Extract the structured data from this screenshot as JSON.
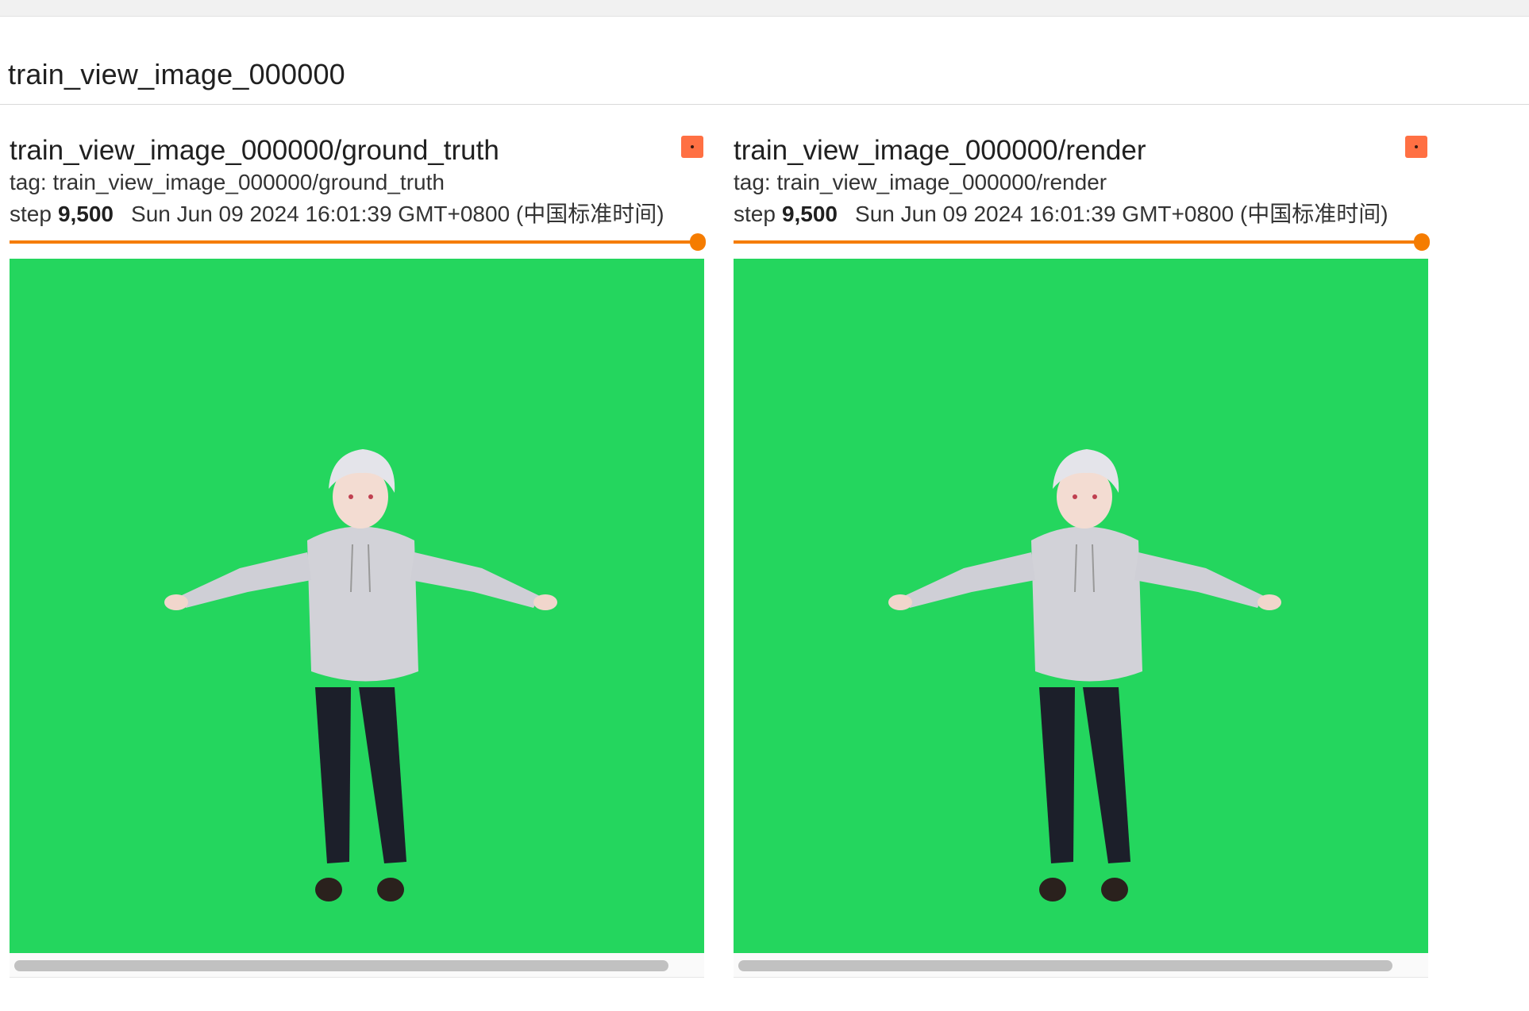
{
  "group": {
    "title": "train_view_image_000000"
  },
  "cards": [
    {
      "title": "train_view_image_000000/ground_truth",
      "tag": "tag: train_view_image_000000/ground_truth",
      "step_label": "step",
      "step_value": "9,500",
      "timestamp": "Sun Jun 09 2024 16:01:39 GMT+0800 (中国标准时间)",
      "menu_icon": "more-menu-icon",
      "slider_position": 1.0,
      "image_background": "#24d65e"
    },
    {
      "title": "train_view_image_000000/render",
      "tag": "tag: train_view_image_000000/render",
      "step_label": "step",
      "step_value": "9,500",
      "timestamp": "Sun Jun 09 2024 16:01:39 GMT+0800 (中国标准时间)",
      "menu_icon": "more-menu-icon",
      "slider_position": 1.0,
      "image_background": "#24d65e"
    }
  ],
  "colors": {
    "accent": "#f57c00",
    "menu_button": "#ff7043",
    "green_screen": "#24d65e"
  }
}
